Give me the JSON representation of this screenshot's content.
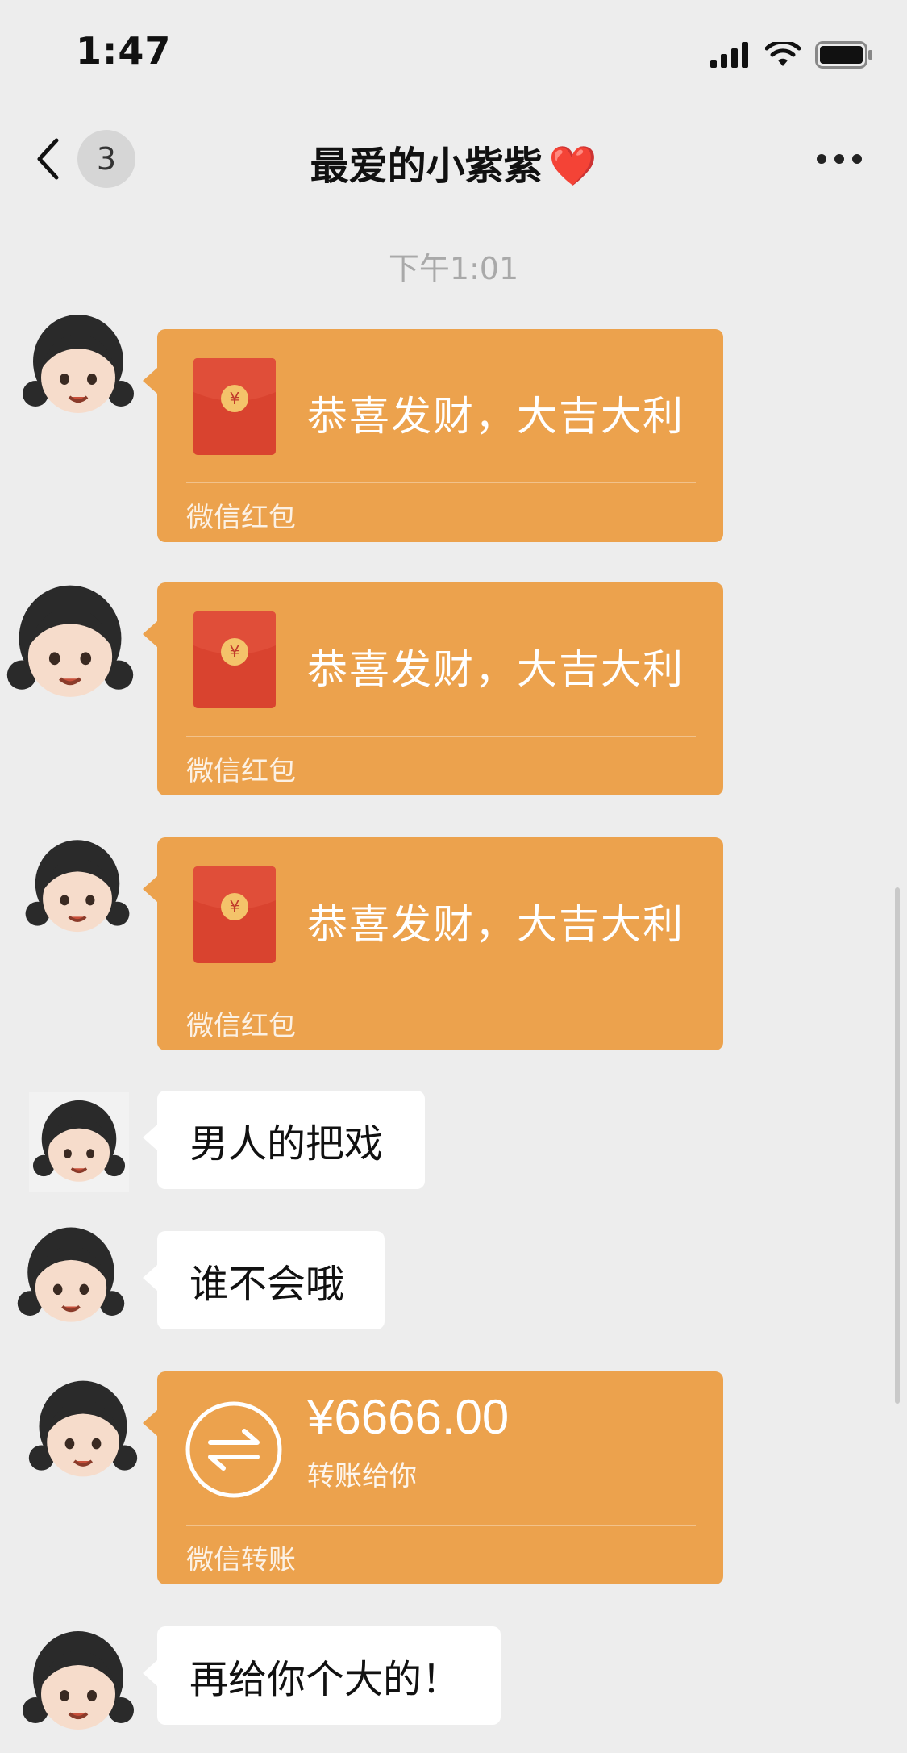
{
  "status_bar": {
    "time": "1:47",
    "icons": [
      "cellular-signal-icon",
      "wifi-icon",
      "battery-icon"
    ]
  },
  "nav": {
    "back_icon": "chevron-left-icon",
    "unread_count": "3",
    "title": "最爱的小紫紫",
    "title_emoji": "❤️",
    "more_icon": "ellipsis-icon"
  },
  "chat": {
    "timestamp": "下午1:01",
    "messages": [
      {
        "type": "red_packet",
        "text": "恭喜发财，大吉大利",
        "footer": "微信红包"
      },
      {
        "type": "red_packet",
        "text": "恭喜发财，大吉大利",
        "footer": "微信红包"
      },
      {
        "type": "red_packet",
        "text": "恭喜发财，大吉大利",
        "footer": "微信红包"
      },
      {
        "type": "text",
        "text": "男人的把戏"
      },
      {
        "type": "text",
        "text": "谁不会哦"
      },
      {
        "type": "transfer",
        "amount": "¥6666.00",
        "note": "转账给你",
        "footer": "微信转账"
      },
      {
        "type": "text",
        "text": "再给你个大的！"
      }
    ]
  },
  "colors": {
    "background": "#ededed",
    "card_orange": "#eca24d",
    "envelope_red": "#d9432f",
    "bubble_white": "#ffffff"
  }
}
